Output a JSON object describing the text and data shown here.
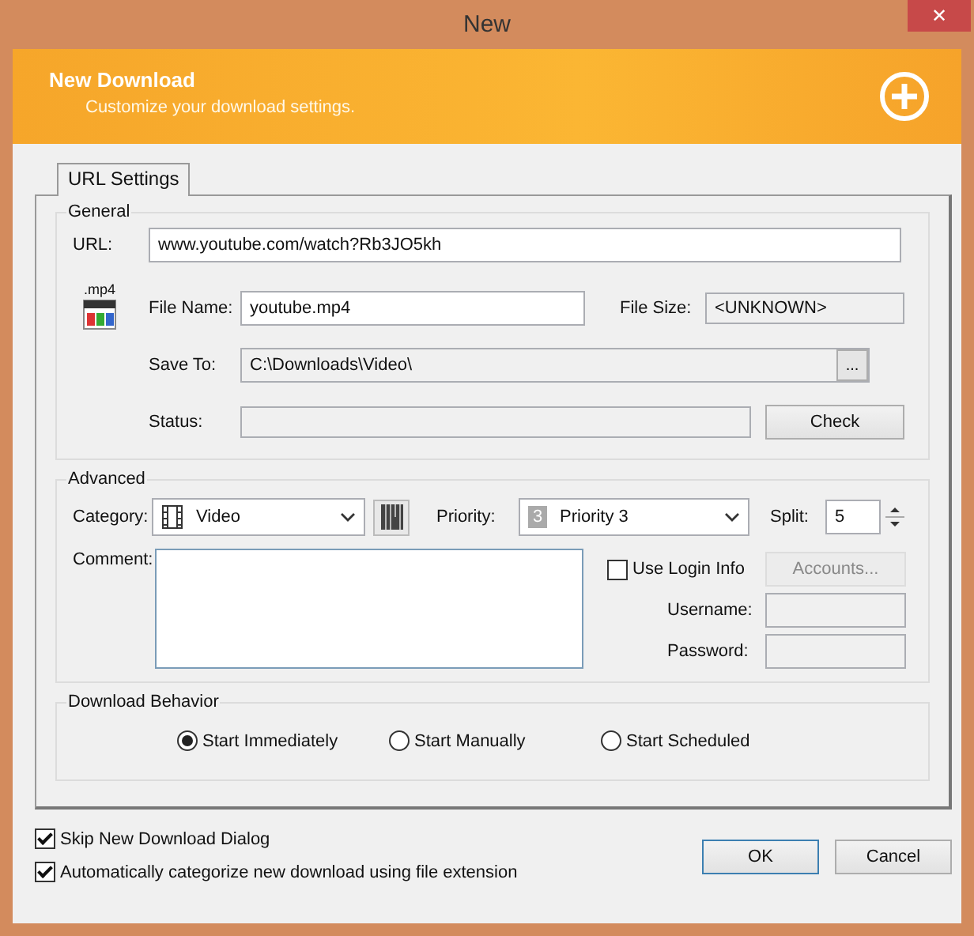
{
  "window": {
    "title": "New",
    "close": "✕"
  },
  "header": {
    "title": "New Download",
    "subtitle": "Customize your download settings."
  },
  "tabs": [
    {
      "label": "URL Settings",
      "selected": true
    }
  ],
  "general": {
    "title": "General",
    "url": {
      "label": "URL:",
      "value": "www.youtube.com/watch?Rb3JO5kh"
    },
    "file_name": {
      "label": "File Name:",
      "value": "youtube.mp4",
      "type_label": ".mp4"
    },
    "file_size": {
      "label": "File Size:",
      "value": "<UNKNOWN>"
    },
    "save_to": {
      "label": "Save To:",
      "value": "C:\\Downloads\\Video\\",
      "browse": "..."
    },
    "status": {
      "label": "Status:"
    },
    "check_button": "Check"
  },
  "advanced": {
    "title": "Advanced",
    "category": {
      "label": "Category:",
      "value": "Video"
    },
    "priority": {
      "label": "Priority:",
      "value": "Priority 3",
      "badge": "3"
    },
    "split": {
      "label": "Split:",
      "value": "5"
    },
    "comment": {
      "label": "Comment:"
    },
    "use_login_info": {
      "label": "Use Login Info",
      "checked": false
    },
    "accounts_button": {
      "label": "Accounts...",
      "disabled": true
    },
    "username": {
      "label": "Username:"
    },
    "password": {
      "label": "Password:"
    }
  },
  "behavior": {
    "title": "Download Behavior",
    "options": [
      {
        "label": "Start Immediately",
        "selected": true
      },
      {
        "label": "Start Manually",
        "selected": false
      },
      {
        "label": "Start Scheduled",
        "selected": false
      }
    ]
  },
  "options": [
    {
      "label": "Skip New Download Dialog",
      "checked": true
    },
    {
      "label": "Automatically categorize new download using file extension",
      "checked": true
    }
  ],
  "buttons": [
    "OK",
    "Cancel"
  ]
}
